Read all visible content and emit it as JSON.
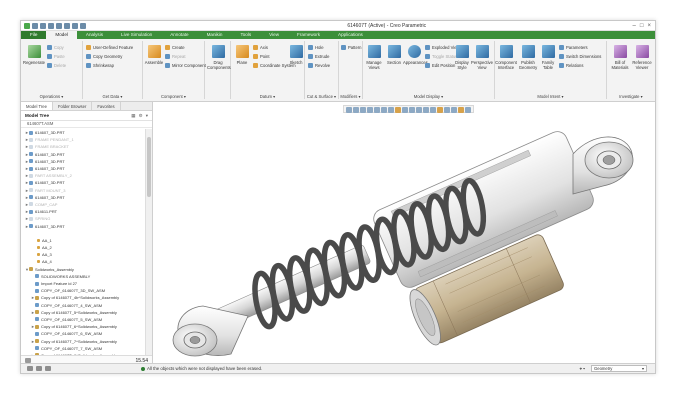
{
  "window": {
    "title": "614607T (Active) - Creo Parametric"
  },
  "tabs": [
    "File",
    "Model",
    "Analysis",
    "Live Simulation",
    "Annotate",
    "Manikin",
    "Tools",
    "View",
    "Framework",
    "Applications"
  ],
  "active_tab": "Model",
  "ribbon": {
    "groups": [
      {
        "id": "operations",
        "label": "Operations ▾"
      },
      {
        "id": "get_data",
        "label": "Get Data ▾"
      },
      {
        "id": "component",
        "label": "Component ▾"
      },
      {
        "id": "datum",
        "label": "Datum ▾"
      },
      {
        "id": "cut_surface",
        "label": "Cut & Surface ▾"
      },
      {
        "id": "modifiers",
        "label": "Modifiers ▾"
      },
      {
        "id": "model_display",
        "label": "Model Display ▾"
      },
      {
        "id": "model_intent",
        "label": "Model Intent ▾"
      },
      {
        "id": "investigate",
        "label": "Investigate ▾"
      }
    ],
    "operations": {
      "regenerate": "Regenerate",
      "copy": "Copy",
      "paste": "Paste",
      "delete": "Delete"
    },
    "get_data": {
      "udf": "User-Defined Feature",
      "copy_geometry": "Copy Geometry",
      "shrinkwrap": "Shrinkwrap"
    },
    "component": {
      "assemble": "Assemble",
      "create": "Create",
      "repeat": "Repeat",
      "mirror": "Mirror Component"
    },
    "drag": "Drag Components",
    "datum": {
      "plane": "Plane",
      "axis": "Axis",
      "point": "Point",
      "csys": "Coordinate System",
      "sketch": "Sketch"
    },
    "cut_surface": {
      "hole": "Hole",
      "extrude": "Extrude",
      "revolve": "Revolve"
    },
    "modifiers": {
      "pattern": "Pattern"
    },
    "model_display": {
      "manage_views": "Manage Views",
      "section": "Section",
      "appearances": "Appearances",
      "exploded": "Exploded View",
      "toggle_status": "Toggle Status",
      "edit_position": "Edit Position",
      "display_style": "Display Style",
      "perspective": "Perspective View"
    },
    "model_intent": {
      "component_interface": "Component Interface",
      "publish_geometry": "Publish Geometry",
      "family_table": "Family Table",
      "parameters": "Parameters",
      "switch_dimensions": "Switch Dimensions",
      "relations": "Relations"
    },
    "investigate": {
      "bom": "Bill of Materials",
      "reference_viewer": "Reference Viewer"
    }
  },
  "panel": {
    "tabs": [
      "Model Tree",
      "Folder Browser",
      "Favorites"
    ],
    "active_tab": "Model Tree",
    "header": "Model Tree",
    "column": "614607T.ASM",
    "footer_value": "15.54"
  },
  "tree": [
    {
      "label": "614607_3D.PRT",
      "type": "part",
      "state": "normal",
      "exp": "►"
    },
    {
      "label": "FRAME PENDANT_1",
      "type": "part",
      "state": "gray",
      "exp": "►"
    },
    {
      "label": "FRAME BRACKET",
      "type": "part",
      "state": "gray",
      "exp": "►"
    },
    {
      "label": "614607_3D.PRT",
      "type": "part",
      "state": "normal",
      "exp": "►"
    },
    {
      "label": "614607_3D.PRT",
      "type": "part",
      "state": "normal",
      "exp": "►"
    },
    {
      "label": "614607_3D.PRT",
      "type": "part",
      "state": "normal",
      "exp": "►"
    },
    {
      "label": "PART ASSEMBLY_2",
      "type": "part",
      "state": "gray",
      "exp": "►"
    },
    {
      "label": "614607_3D.PRT",
      "type": "part",
      "state": "normal",
      "exp": "►"
    },
    {
      "label": "PART MOUNT_3",
      "type": "part",
      "state": "gray",
      "exp": "►"
    },
    {
      "label": "614607_3D.PRT",
      "type": "part",
      "state": "normal",
      "exp": "►"
    },
    {
      "label": "COMP_CAP",
      "type": "part",
      "state": "gray",
      "exp": "►"
    },
    {
      "label": "614611.PRT",
      "type": "part",
      "state": "normal",
      "exp": "►"
    },
    {
      "label": "SPRING",
      "type": "part",
      "state": "gray",
      "exp": "►"
    },
    {
      "label": "614607_3D.PRT",
      "type": "part",
      "state": "normal",
      "exp": "►"
    },
    {
      "label": "",
      "type": "blank",
      "state": "normal",
      "exp": ""
    },
    {
      "label": "AA_1",
      "type": "datum",
      "state": "normal",
      "exp": ""
    },
    {
      "label": "AA_2",
      "type": "datum",
      "state": "normal",
      "exp": ""
    },
    {
      "label": "AA_3",
      "type": "datum",
      "state": "normal",
      "exp": ""
    },
    {
      "label": "AA_4",
      "type": "datum",
      "state": "normal",
      "exp": ""
    },
    {
      "label": "Solidworks_Assembly",
      "type": "asm",
      "state": "normal",
      "exp": "▼"
    },
    {
      "label": "SOLIDWORKS ASSEMBLY",
      "type": "part",
      "state": "normal",
      "exp": ""
    },
    {
      "label": "Import Feature id 27",
      "type": "part",
      "state": "normal",
      "exp": ""
    },
    {
      "label": "COPY_OF_614607T_3D_SW_ASM",
      "type": "part",
      "state": "normal",
      "exp": ""
    },
    {
      "label": "Copy of 614607T_4b^Solidworks_Assembly",
      "type": "asm",
      "state": "normal",
      "exp": "►"
    },
    {
      "label": "COPY_OF_614607T_4_SW_ASM",
      "type": "part",
      "state": "normal",
      "exp": ""
    },
    {
      "label": "Copy of 614607T_5^Solidworks_Assembly",
      "type": "asm",
      "state": "normal",
      "exp": "►"
    },
    {
      "label": "COPY_OF_614607T_5_SW_ASM",
      "type": "part",
      "state": "normal",
      "exp": ""
    },
    {
      "label": "Copy of 614607T_6^Solidworks_Assembly",
      "type": "asm",
      "state": "normal",
      "exp": "►"
    },
    {
      "label": "COPY_OF_614607T_6_SW_ASM",
      "type": "part",
      "state": "normal",
      "exp": ""
    },
    {
      "label": "Copy of 614607T_7^Solidworks_Assembly",
      "type": "asm",
      "state": "normal",
      "exp": "►"
    },
    {
      "label": "COPY_OF_614607T_7_SW_ASM",
      "type": "part",
      "state": "normal",
      "exp": ""
    },
    {
      "label": "Copy of 614607T_8^Solidworks_Assembly",
      "type": "asm",
      "state": "normal",
      "exp": "►"
    }
  ],
  "status": {
    "message": "All the objects which were not displayed have been erased.",
    "filter": "Geometry"
  }
}
